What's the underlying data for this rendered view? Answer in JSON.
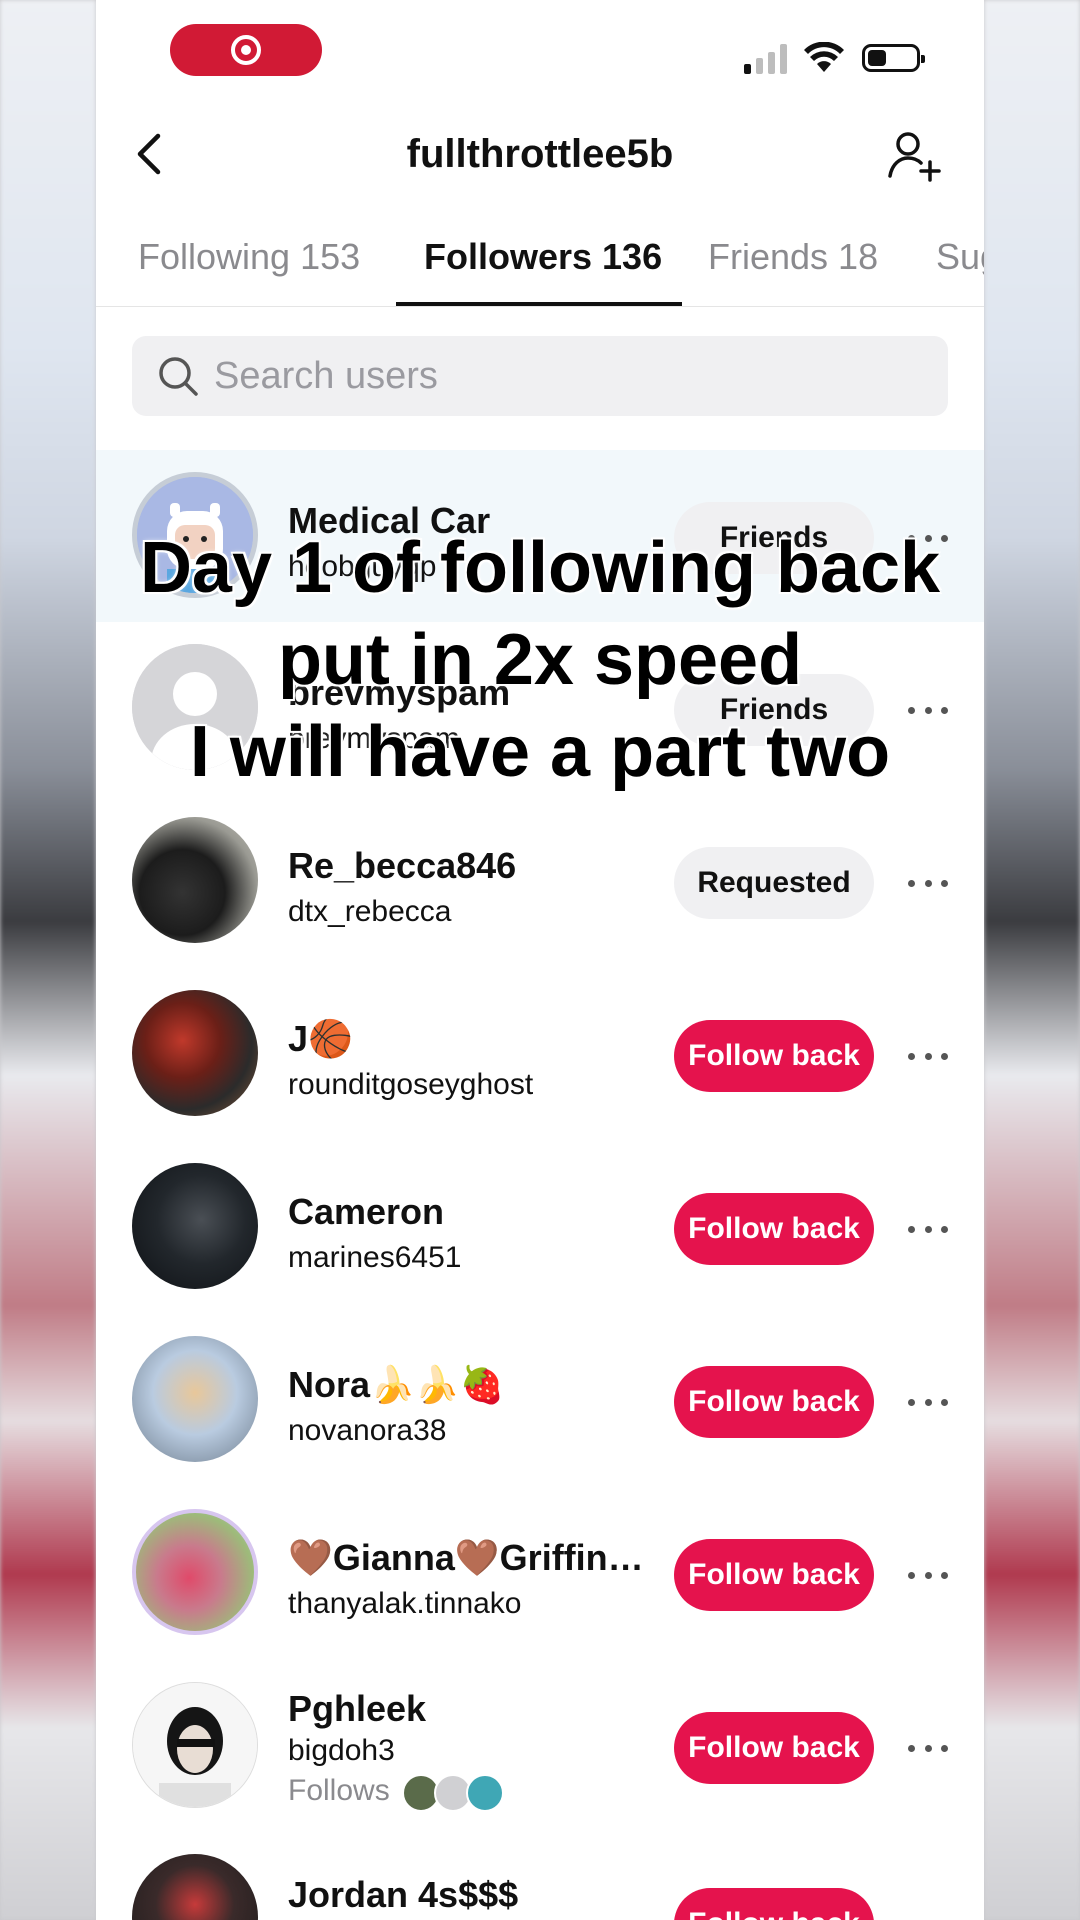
{
  "status_bar": {
    "recording_indicator": "record-icon",
    "icons": [
      "signal-icon",
      "wifi-icon",
      "battery-icon"
    ]
  },
  "header": {
    "title": "fullthrottlee5b",
    "back_icon": "chevron-left-icon",
    "add_user_icon": "add-user-icon"
  },
  "tabs": [
    {
      "label": "Following 153"
    },
    {
      "label": "Followers 136"
    },
    {
      "label": "Friends 18"
    },
    {
      "label": "Sug"
    }
  ],
  "active_tab": "Followers 136",
  "search": {
    "placeholder": "Search users",
    "value": ""
  },
  "followers": [
    {
      "name": "Medical Car",
      "handle": "hoobguyqp",
      "button": "Friends",
      "button_style": "grey"
    },
    {
      "name": "brevmyspam",
      "handle": "brevmyspam",
      "button": "Friends",
      "button_style": "grey"
    },
    {
      "name": "Re_becca846",
      "handle": "dtx_rebecca",
      "button": "Requested",
      "button_style": "grey"
    },
    {
      "name": "J🏀",
      "handle": "rounditgoseyghost",
      "button": "Follow back",
      "button_style": "red"
    },
    {
      "name": "Cameron",
      "handle": "marines6451",
      "button": "Follow back",
      "button_style": "red"
    },
    {
      "name": "Nora🍌🍌🍓",
      "handle": "novanora38",
      "button": "Follow back",
      "button_style": "red"
    },
    {
      "name": "🤎Gianna🤎Griffin…",
      "handle": "thanyalak.tinnako",
      "button": "Follow back",
      "button_style": "red"
    },
    {
      "name": "Pghleek",
      "handle": "bigdoh3",
      "button": "Follow back",
      "button_style": "red",
      "follows_label": "Follows"
    },
    {
      "name": "Jordan 4s$$$",
      "handle": "",
      "button": "Follow back",
      "button_style": "red"
    }
  ],
  "overlay_caption": [
    "Day 1 of following back",
    "put in 2x speed",
    "I will have a part two"
  ],
  "colors": {
    "accent_red": "#e5134d",
    "recording_red": "#d11a35",
    "grey_button": "#f0f0f2",
    "highlight_row": "#f2f8fb"
  }
}
